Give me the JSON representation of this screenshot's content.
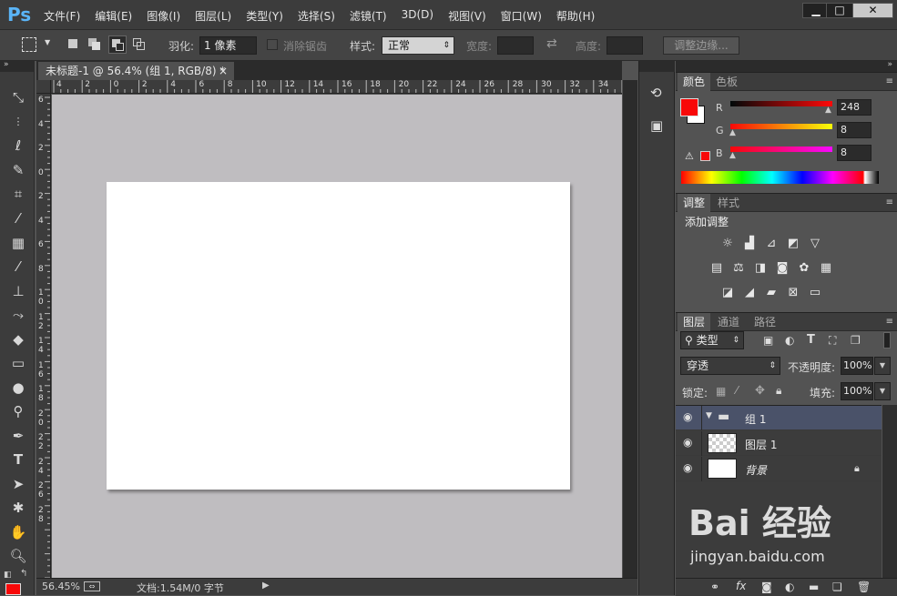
{
  "app": {
    "logo": "Ps"
  },
  "menu": [
    "文件(F)",
    "编辑(E)",
    "图像(I)",
    "图层(L)",
    "类型(Y)",
    "选择(S)",
    "滤镜(T)",
    "3D(D)",
    "视图(V)",
    "窗口(W)",
    "帮助(H)"
  ],
  "window_controls": {
    "minimize": "▁",
    "restore": "□",
    "close": "✕"
  },
  "options": {
    "feather_label": "羽化:",
    "feather_value": "1 像素",
    "antialias_label": "消除锯齿",
    "style_label": "样式:",
    "style_value": "正常",
    "width_label": "宽度:",
    "height_label": "高度:",
    "refine_edge": "调整边缘..."
  },
  "document": {
    "tab_title": "未标题-1 @ 56.4% (组 1, RGB/8) *",
    "close": "×",
    "zoom": "56.45%",
    "status": "文档:1.54M/0 字节"
  },
  "rulers": {
    "h": [
      "4",
      "2",
      "0",
      "2",
      "4",
      "6",
      "8",
      "10",
      "12",
      "14",
      "16",
      "18",
      "20",
      "22",
      "24",
      "26",
      "28",
      "30",
      "32",
      "34"
    ],
    "v": [
      "6",
      "4",
      "2",
      "0",
      "2",
      "4",
      "6",
      "8",
      "1\n0",
      "1\n2",
      "1\n4",
      "1\n6",
      "1\n8",
      "2\n0",
      "2\n2",
      "2\n4",
      "2\n6",
      "2\n8"
    ]
  },
  "color_panel": {
    "tabs": [
      "颜色",
      "色板"
    ],
    "r_label": "R",
    "r_value": "248",
    "g_label": "G",
    "g_value": "8",
    "b_label": "B",
    "b_value": "8",
    "foreground": "#f80808",
    "background": "#ffffff"
  },
  "adjustments_panel": {
    "tabs": [
      "调整",
      "样式"
    ],
    "title": "添加调整"
  },
  "layers_panel": {
    "tabs": [
      "图层",
      "通道",
      "路径"
    ],
    "filter_kind": "类型",
    "blend_mode": "穿透",
    "opacity_label": "不透明度:",
    "opacity_value": "100%",
    "lock_label": "锁定:",
    "fill_label": "填充:",
    "fill_value": "100%",
    "layers": [
      {
        "name": "组 1",
        "kind": "group"
      },
      {
        "name": "图层 1",
        "kind": "transparent"
      },
      {
        "name": "背景",
        "kind": "background"
      }
    ]
  },
  "watermark": {
    "brand": "Bai 经验",
    "url": "jingyan.baidu.com"
  }
}
